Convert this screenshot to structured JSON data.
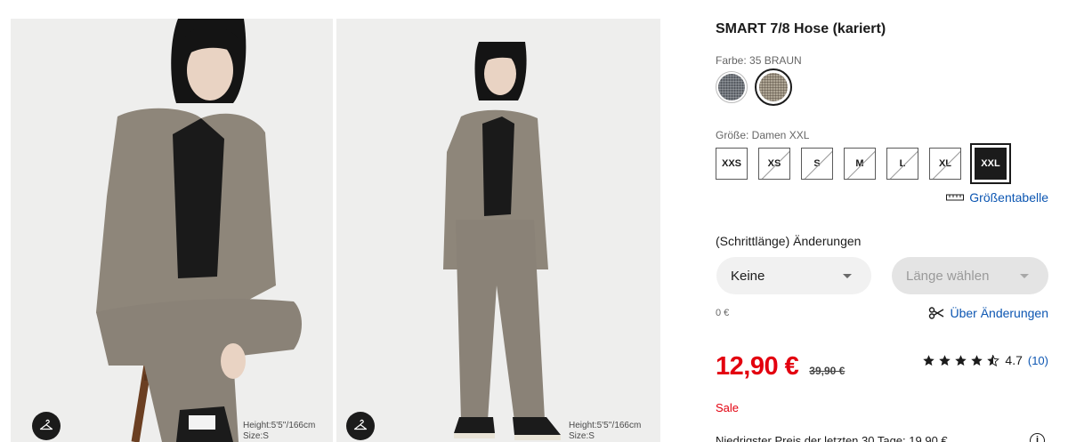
{
  "gallery": {
    "images": [
      {
        "alt": "Model sitting on stool wearing SMART 7/8 Hose (kariert)",
        "model_height": "Height:5'5''/166cm",
        "model_size": "Size:S"
      },
      {
        "alt": "Model standing wearing SMART 7/8 Hose (kariert)",
        "model_height": "Height:5'5''/166cm",
        "model_size": "Size:S"
      }
    ],
    "try_on_icon": "hanger-icon"
  },
  "product": {
    "title": "SMART 7/8 Hose (kariert)",
    "color_label": "Farbe: 35 BRAUN",
    "colors": [
      {
        "name": "gray-check",
        "hex": "#6e737a",
        "selected": false
      },
      {
        "name": "brown-check",
        "hex": "#aea594",
        "selected": true
      }
    ],
    "size_label": "Größe: Damen XXL",
    "sizes": [
      {
        "label": "XXS",
        "available": true,
        "selected": false
      },
      {
        "label": "XS",
        "available": false,
        "selected": false
      },
      {
        "label": "S",
        "available": false,
        "selected": false
      },
      {
        "label": "M",
        "available": false,
        "selected": false
      },
      {
        "label": "L",
        "available": false,
        "selected": false
      },
      {
        "label": "XL",
        "available": false,
        "selected": false
      },
      {
        "label": "XXL",
        "available": true,
        "selected": true
      }
    ],
    "size_chart_link": "Größentabelle",
    "alterations": {
      "title": "(Schrittlänge) Änderungen",
      "option_value": "Keine",
      "length_placeholder": "Länge wählen",
      "price": "0 €",
      "info_link": "Über Änderungen"
    },
    "price": "12,90 €",
    "old_price": "39,90 €",
    "rating": {
      "stars": 4.7,
      "value": "4.7",
      "count": "(10)"
    },
    "sale_label": "Sale",
    "lowest_price_note": "Niedrigster Preis der letzten 30 Tage: 19,90 €",
    "colors_theme": {
      "price_red": "#e3000f",
      "link_blue": "#0c56b2",
      "text": "#1b1b1b"
    }
  }
}
